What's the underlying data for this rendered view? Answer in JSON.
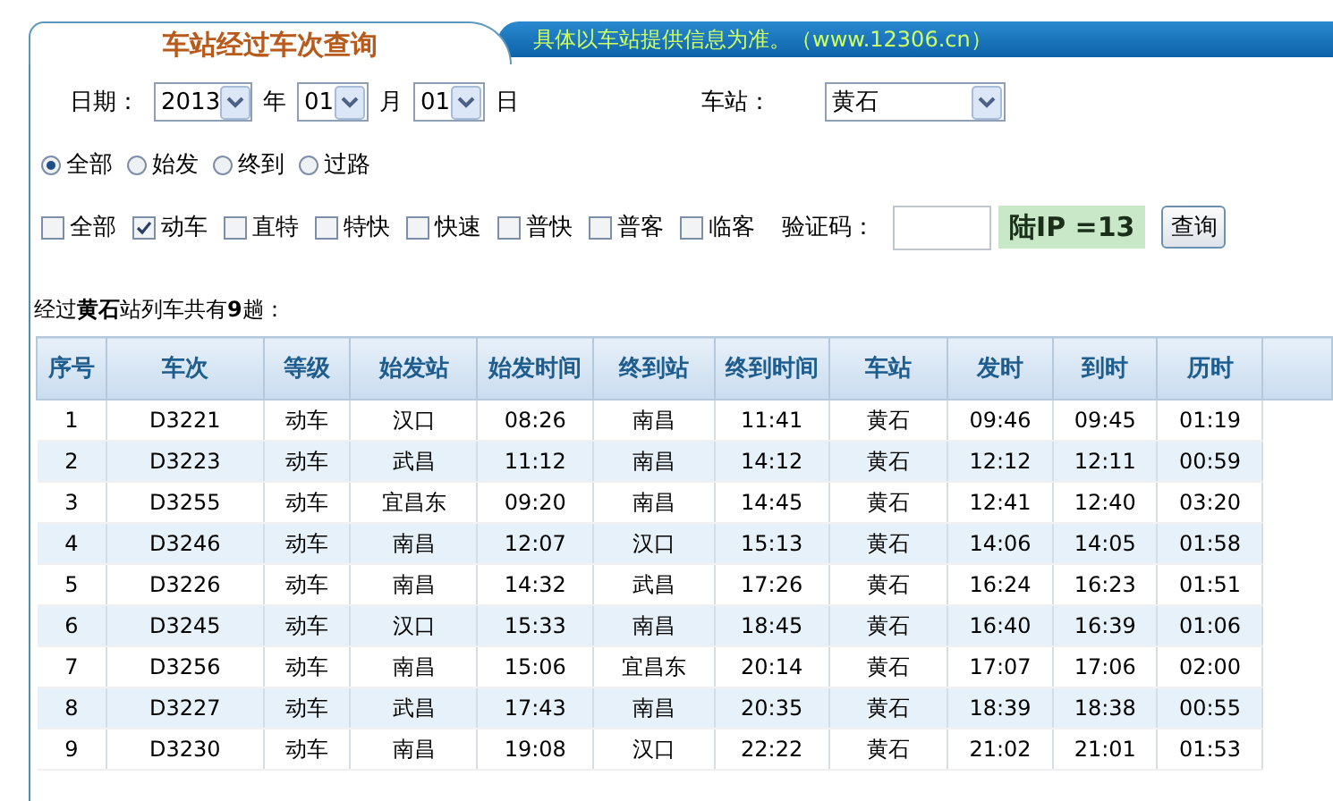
{
  "header": {
    "title": "车站经过车次查询",
    "notice": "具体以车站提供信息为准。（www.12306.cn）"
  },
  "date": {
    "label": "日期：",
    "year": "2013",
    "year_unit": "年",
    "month": "01",
    "month_unit": "月",
    "day": "01",
    "day_unit": "日"
  },
  "station": {
    "label": "车站：",
    "value": "黄石"
  },
  "direction_options": [
    {
      "label": "全部",
      "selected": true
    },
    {
      "label": "始发",
      "selected": false
    },
    {
      "label": "终到",
      "selected": false
    },
    {
      "label": "过路",
      "selected": false
    }
  ],
  "train_types": [
    {
      "label": "全部",
      "checked": false
    },
    {
      "label": "动车",
      "checked": true
    },
    {
      "label": "直特",
      "checked": false
    },
    {
      "label": "特快",
      "checked": false
    },
    {
      "label": "快速",
      "checked": false
    },
    {
      "label": "普快",
      "checked": false
    },
    {
      "label": "普客",
      "checked": false
    },
    {
      "label": "临客",
      "checked": false
    }
  ],
  "captcha": {
    "label": "验证码：",
    "image_text": "陆IP =13"
  },
  "query_button": "查询",
  "summary": "经过**黄石**站列车共有**9**趟：",
  "table": {
    "columns": [
      "序号",
      "车次",
      "等级",
      "始发站",
      "始发时间",
      "终到站",
      "终到时间",
      "车站",
      "发时",
      "到时",
      "历时"
    ],
    "rows": [
      [
        "1",
        "D3221",
        "动车",
        "汉口",
        "08:26",
        "南昌",
        "11:41",
        "黄石",
        "09:46",
        "09:45",
        "01:19"
      ],
      [
        "2",
        "D3223",
        "动车",
        "武昌",
        "11:12",
        "南昌",
        "14:12",
        "黄石",
        "12:12",
        "12:11",
        "00:59"
      ],
      [
        "3",
        "D3255",
        "动车",
        "宜昌东",
        "09:20",
        "南昌",
        "14:45",
        "黄石",
        "12:41",
        "12:40",
        "03:20"
      ],
      [
        "4",
        "D3246",
        "动车",
        "南昌",
        "12:07",
        "汉口",
        "15:13",
        "黄石",
        "14:06",
        "14:05",
        "01:58"
      ],
      [
        "5",
        "D3226",
        "动车",
        "南昌",
        "14:32",
        "武昌",
        "17:26",
        "黄石",
        "16:24",
        "16:23",
        "01:51"
      ],
      [
        "6",
        "D3245",
        "动车",
        "汉口",
        "15:33",
        "南昌",
        "18:45",
        "黄石",
        "16:40",
        "16:39",
        "01:06"
      ],
      [
        "7",
        "D3256",
        "动车",
        "南昌",
        "15:06",
        "宜昌东",
        "20:14",
        "黄石",
        "17:07",
        "17:06",
        "02:00"
      ],
      [
        "8",
        "D3227",
        "动车",
        "武昌",
        "17:43",
        "南昌",
        "20:35",
        "黄石",
        "18:39",
        "18:38",
        "00:55"
      ],
      [
        "9",
        "D3230",
        "动车",
        "南昌",
        "19:08",
        "汉口",
        "22:22",
        "黄石",
        "21:02",
        "21:01",
        "01:53"
      ]
    ]
  }
}
